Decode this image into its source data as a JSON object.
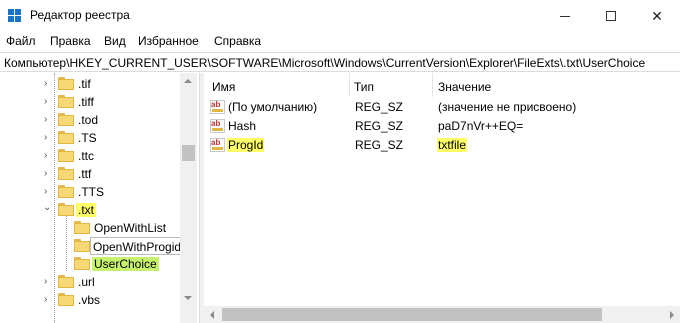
{
  "window": {
    "title": "Редактор реестра",
    "icon": "registry-editor-icon",
    "controls": {
      "minimize": "minimize-icon",
      "maximize": "maximize-icon",
      "close": "✕"
    }
  },
  "menu": [
    "Файл",
    "Правка",
    "Вид",
    "Избранное",
    "Справка"
  ],
  "address": "Компьютер\\HKEY_CURRENT_USER\\SOFTWARE\\Microsoft\\Windows\\CurrentVersion\\Explorer\\FileExts\\.txt\\UserChoice",
  "tree": {
    "items": [
      {
        "label": ".tif",
        "expander": "›"
      },
      {
        "label": ".tiff",
        "expander": "›"
      },
      {
        "label": ".tod",
        "expander": "›"
      },
      {
        "label": ".TS",
        "expander": "›"
      },
      {
        "label": ".ttc",
        "expander": "›"
      },
      {
        "label": ".ttf",
        "expander": "›"
      },
      {
        "label": ".TTS",
        "expander": "›"
      },
      {
        "label": ".txt",
        "expander": "⌄",
        "highlight": "#ffff66"
      },
      {
        "label": "OpenWithList",
        "expander": ""
      },
      {
        "label": "OpenWithProgids",
        "expander": ""
      },
      {
        "label": "UserChoice",
        "expander": "",
        "highlight": "#c6f26e"
      },
      {
        "label": ".url",
        "expander": "›"
      },
      {
        "label": ".vbs",
        "expander": "›"
      }
    ]
  },
  "values": {
    "headers": {
      "name": "Имя",
      "type": "Тип",
      "data": "Значение"
    },
    "rows": [
      {
        "name": "(По умолчанию)",
        "type": "REG_SZ",
        "data": "(значение не присвоено)"
      },
      {
        "name": "Hash",
        "type": "REG_SZ",
        "data": "paD7nVr++EQ="
      },
      {
        "name": "ProgId",
        "type": "REG_SZ",
        "data": "txtfile",
        "highlight": "#ffff66"
      }
    ]
  },
  "colors": {
    "highlight_yellow": "#ffff66",
    "highlight_green": "#c6f26e",
    "folder": "#f8d775",
    "accent_icon": "#1a73c8"
  }
}
